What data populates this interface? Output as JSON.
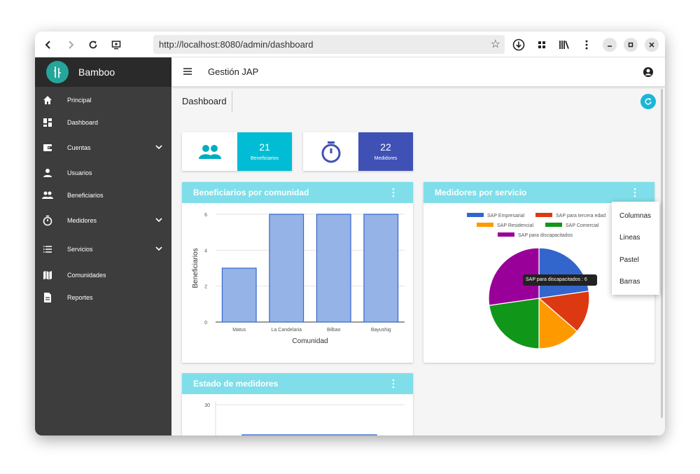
{
  "browser": {
    "url": "http://localhost:8080/admin/dashboard"
  },
  "sidebar": {
    "brand": "Bamboo",
    "items": [
      {
        "label": "Principal",
        "icon": "home-icon"
      },
      {
        "label": "Dashboard",
        "icon": "dashboard-icon"
      },
      {
        "label": "Cuentas",
        "icon": "wallet-icon",
        "expandable": true
      },
      {
        "label": "Usuarios",
        "icon": "person-icon"
      },
      {
        "label": "Beneficiarios",
        "icon": "people-icon"
      },
      {
        "label": "Medidores",
        "icon": "timer-icon",
        "expandable": true
      },
      {
        "label": "Servicios",
        "icon": "list-icon",
        "expandable": true
      },
      {
        "label": "Comunidades",
        "icon": "map-icon"
      },
      {
        "label": "Reportes",
        "icon": "document-icon"
      }
    ]
  },
  "header": {
    "title": "Gestión JAP"
  },
  "page": {
    "title": "Dashboard"
  },
  "stats": [
    {
      "value": "21",
      "label": "Beneficiarios",
      "color": "#00bcd4",
      "icon": "people-icon"
    },
    {
      "value": "22",
      "label": "Medidores",
      "color": "#3f51b5",
      "icon": "timer-icon"
    }
  ],
  "cards": {
    "beneficiarios": {
      "title": "Beneficiarios por comunidad"
    },
    "medidores": {
      "title": "Medidores por servicio"
    },
    "estado": {
      "title": "Estado de medidores"
    }
  },
  "dropdown": {
    "options": [
      "Columnas",
      "Lineas",
      "Pastel",
      "Barras"
    ]
  },
  "tooltip": {
    "text": "SAP para discapacitados : 6"
  },
  "chart_data": [
    {
      "type": "bar",
      "title": "Beneficiarios por comunidad",
      "categories": [
        "Matus",
        "La Candelaria",
        "Bilbao",
        "Bayushig"
      ],
      "values": [
        3,
        6,
        6,
        6
      ],
      "xlabel": "Comunidad",
      "ylabel": "Beneficiarios",
      "ylim": [
        0,
        6
      ],
      "yticks": [
        "0",
        "2",
        "4",
        "6"
      ],
      "color": "#95b3e6",
      "grid": true
    },
    {
      "type": "pie",
      "title": "Medidores por servicio",
      "legend_position": "top",
      "slices": [
        {
          "name": "SAP Empresarial",
          "value": 5,
          "color": "#3366cc"
        },
        {
          "name": "SAP para tercera edad",
          "value": 3,
          "color": "#dc3912"
        },
        {
          "name": "SAP Residencial",
          "value": 3,
          "color": "#ff9900"
        },
        {
          "name": "SAP Comercial",
          "value": 5,
          "color": "#109618"
        },
        {
          "name": "SAP para discapacitados",
          "value": 6,
          "color": "#990099"
        }
      ]
    },
    {
      "type": "bar",
      "title": "Estado de medidores",
      "yticks": [
        "30"
      ],
      "ylim": [
        0,
        30
      ],
      "values": [
        30
      ],
      "color": "#95b3e6"
    }
  ]
}
